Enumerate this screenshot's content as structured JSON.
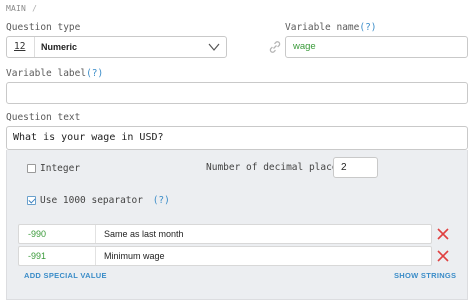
{
  "breadcrumb": {
    "section": "MAIN",
    "separator": "/"
  },
  "question_type": {
    "label": "Question type",
    "type_number": "12",
    "value": "Numeric"
  },
  "variable_name": {
    "label": "Variable name",
    "help": "(?)",
    "value": "wage"
  },
  "variable_label": {
    "label": "Variable label",
    "help": "(?)",
    "value": ""
  },
  "question_text": {
    "label": "Question text",
    "value": "What is your wage in USD?"
  },
  "options": {
    "integer_label": "Integer",
    "integer_checked": false,
    "decimal_places_label": "Number of decimal places",
    "decimal_places_value": "2",
    "separator_label": "Use 1000 separator",
    "separator_help": "(?)",
    "separator_checked": true
  },
  "special_values": [
    {
      "code": "-990",
      "label": "Same as last month"
    },
    {
      "code": "-991",
      "label": "Minimum wage"
    }
  ],
  "actions": {
    "add_special_value": "ADD SPECIAL VALUE",
    "show_strings": "SHOW STRINGS"
  },
  "colors": {
    "accent": "#3a8cc8",
    "code_green": "#3a9a3a",
    "delete_red": "#e04040",
    "panel_bg": "#eceef1"
  }
}
